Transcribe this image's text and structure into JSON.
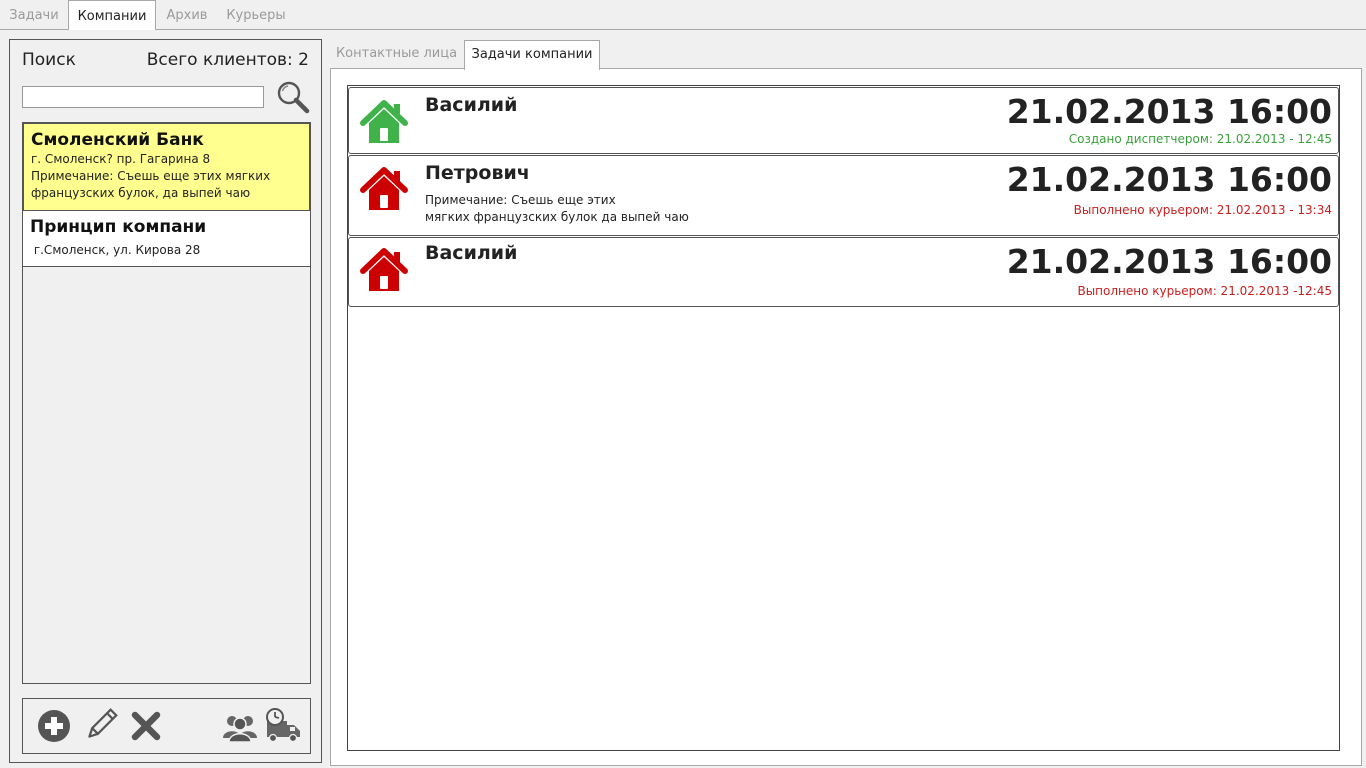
{
  "top_tabs": [
    {
      "label": "Задачи",
      "active": false
    },
    {
      "label": "Компании",
      "active": true
    },
    {
      "label": "Архив",
      "active": false
    },
    {
      "label": "Курьеры",
      "active": false
    }
  ],
  "left": {
    "search_label": "Поиск",
    "total_clients": "Всего клиентов: 2",
    "search_value": "",
    "clients": [
      {
        "name": "Смоленский Банк",
        "address": "г. Смоленск? пр. Гагарина 8",
        "note_line1": "Примечание: Съешь еще этих мягких",
        "note_line2": "французских булок, да выпей чаю",
        "selected": true
      },
      {
        "name": "Принцип компани",
        "address": " г.Смоленск, ул. Кирова 28",
        "selected": false
      }
    ],
    "toolbar_icons": [
      "add-icon",
      "edit-icon",
      "delete-icon",
      "contacts-icon",
      "delivery-schedule-icon"
    ]
  },
  "sub_tabs": [
    {
      "label": "Контактные лица",
      "active": false
    },
    {
      "label": "Задачи компании",
      "active": true
    }
  ],
  "tasks": [
    {
      "name": "Василий",
      "date": "21.02.2013 16:00",
      "status": "Создано диспетчером: 21.02.2013 - 12:45",
      "status_color": "#3aa13a",
      "icon_color": "#3fb34a"
    },
    {
      "name": "Петрович",
      "note_line1": "Примечание: Съешь еще этих",
      "note_line2": "мягких французских булок да выпей чаю",
      "date": "21.02.2013 16:00",
      "status": "Выполнено курьером: 21.02.2013 - 13:34",
      "status_color": "#c81e1e",
      "icon_color": "#cc0000"
    },
    {
      "name": "Василий",
      "date": "21.02.2013 16:00",
      "status": "Выполнено курьером: 21.02.2013 -12:45",
      "status_color": "#c81e1e",
      "icon_color": "#cc0000"
    }
  ]
}
